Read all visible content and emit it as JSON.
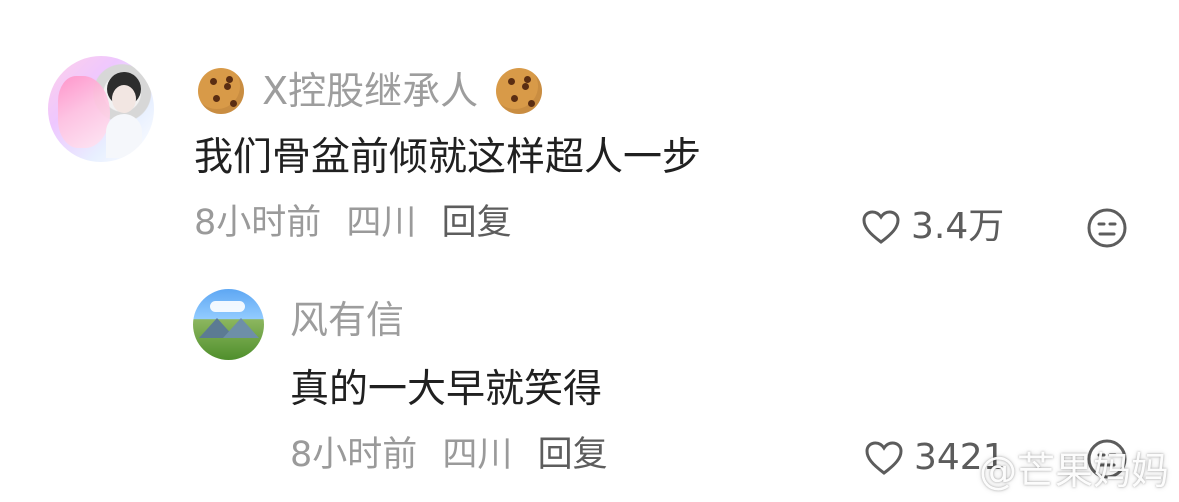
{
  "comments": [
    {
      "username": "X控股继承人",
      "text": "我们骨盆前倾就这样超人一步",
      "time": "8小时前",
      "location": "四川",
      "reply_label": "回复",
      "likes": "3.4万"
    }
  ],
  "reply": {
    "username": "风有信",
    "text": "真的一大早就笑得",
    "time": "8小时前",
    "location": "四川",
    "reply_label": "回复",
    "likes": "3421"
  },
  "watermark": "@芒果妈妈",
  "icons": {
    "main_avatar": "profile-avatar",
    "reply_avatar": "landscape-avatar",
    "username_badge": "cookie-icon",
    "like": "heart-icon",
    "emoji": "emoji-face-icon"
  },
  "colors": {
    "primary_text": "#202020",
    "secondary_text": "#9a9a9a",
    "action_text": "#5d5d5d"
  }
}
